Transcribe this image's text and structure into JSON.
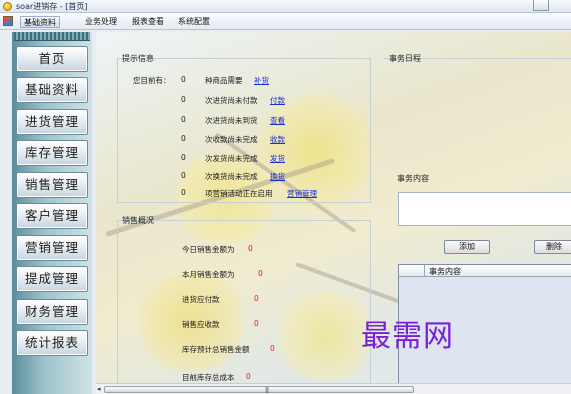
{
  "window": {
    "title": "soar进销存 - [首页]"
  },
  "menu": {
    "items": [
      {
        "label": "基础资料",
        "active": true
      },
      {
        "label": "业务处理",
        "active": false
      },
      {
        "label": "报表查看",
        "active": false
      },
      {
        "label": "系统配置",
        "active": false
      }
    ]
  },
  "sidebar": {
    "items": [
      "首页",
      "基础资料",
      "进货管理",
      "库存管理",
      "销售管理",
      "客户管理",
      "营销管理",
      "提成管理",
      "财务管理",
      "统计报表"
    ]
  },
  "tips": {
    "title": "提示信息",
    "lead": "您目前有：",
    "rows": [
      {
        "count": "0",
        "text": "种商品需要",
        "link": "补货"
      },
      {
        "count": "0",
        "text": "次进货尚未付款",
        "link": "付款"
      },
      {
        "count": "0",
        "text": "次进货尚未到货",
        "link": "查看"
      },
      {
        "count": "0",
        "text": "次收款尚未完成",
        "link": "收款"
      },
      {
        "count": "0",
        "text": "次发货尚未完成",
        "link": "发货"
      },
      {
        "count": "0",
        "text": "次换货尚未完成",
        "link": "换货"
      },
      {
        "count": "0",
        "text": "项营销活动正在启用",
        "link": "营销管理"
      }
    ]
  },
  "sales": {
    "title": "销售概况",
    "rows": [
      {
        "label": "今日销售金额为",
        "value": "0"
      },
      {
        "label": "本月销售金额为",
        "value": "0"
      },
      {
        "label": "进货应付款",
        "value": "0"
      },
      {
        "label": "销售应收款",
        "value": "0"
      },
      {
        "label": "库存预计总销售金额",
        "value": "0"
      },
      {
        "label": "目前库存总成本",
        "value": "0"
      }
    ]
  },
  "events": {
    "title": "事务日程",
    "content_label": "事务内容",
    "content_value": "",
    "add_label": "添加",
    "delete_label": "删除",
    "grid_header": "事务内容"
  },
  "scrollbar": {
    "left_arrow": "◂",
    "grip": "|||"
  },
  "watermark": "最需网",
  "colors": {
    "link": "#1a2fd0",
    "value_red": "#e02020",
    "watermark": "#7a1fd6"
  }
}
